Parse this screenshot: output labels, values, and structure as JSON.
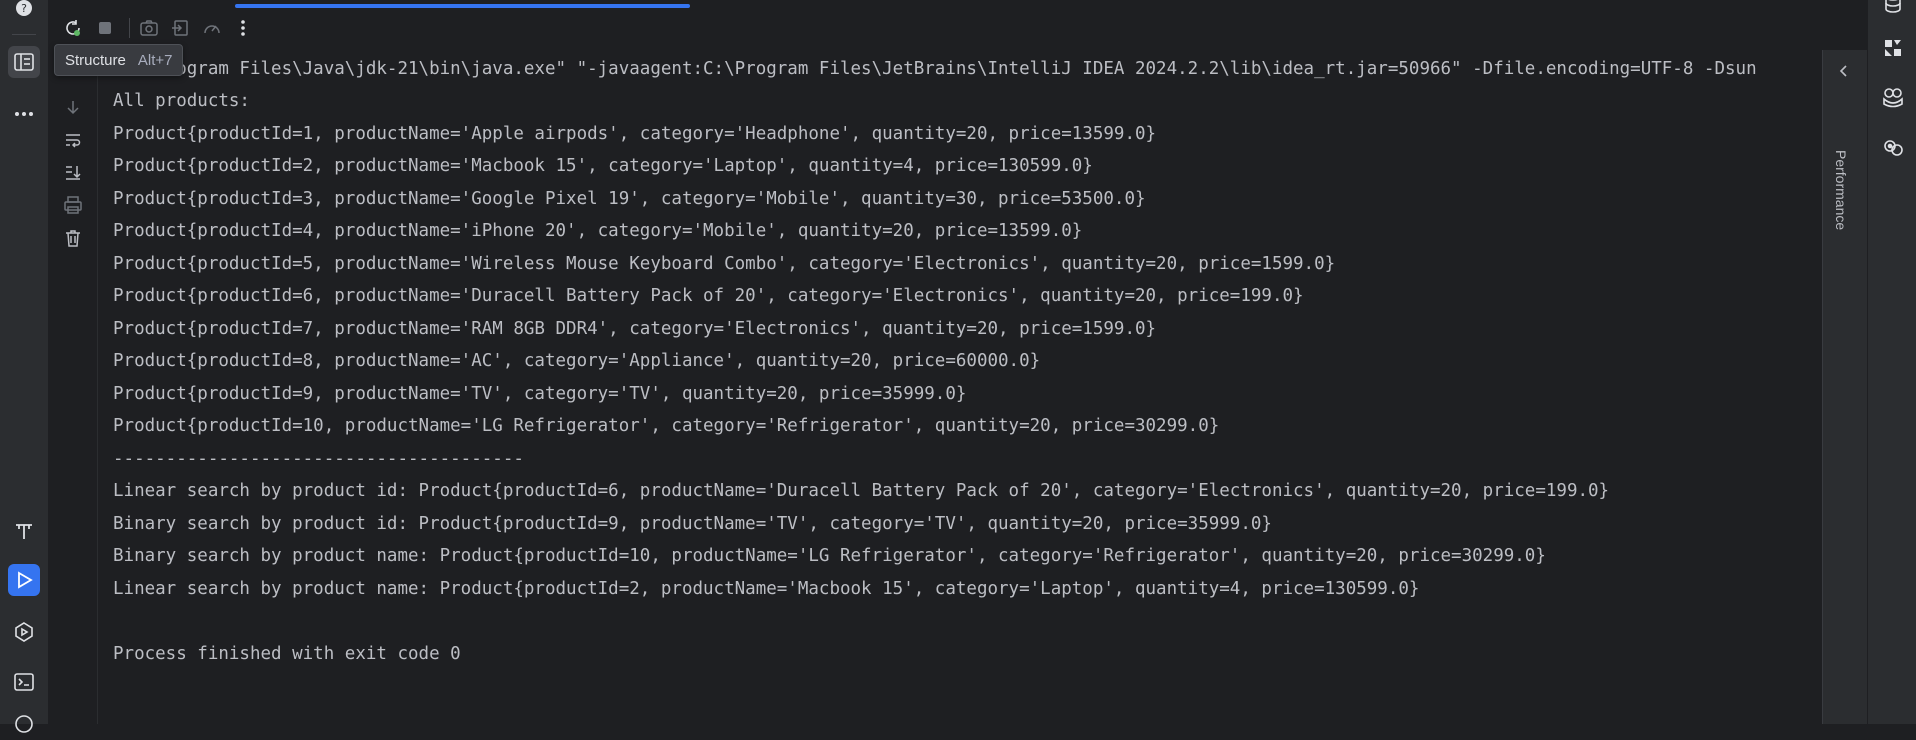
{
  "tooltip": {
    "title": "Structure",
    "shortcut": "Alt+7"
  },
  "right_panel": {
    "label": "Performance"
  },
  "console": {
    "lines": [
      "\"C:\\Program Files\\Java\\jdk-21\\bin\\java.exe\" \"-javaagent:C:\\Program Files\\JetBrains\\IntelliJ IDEA 2024.2.2\\lib\\idea_rt.jar=50966\" -Dfile.encoding=UTF-8 -Dsun",
      "All products:",
      "Product{productId=1, productName='Apple airpods', category='Headphone', quantity=20, price=13599.0}",
      "Product{productId=2, productName='Macbook 15', category='Laptop', quantity=4, price=130599.0}",
      "Product{productId=3, productName='Google Pixel 19', category='Mobile', quantity=30, price=53500.0}",
      "Product{productId=4, productName='iPhone 20', category='Mobile', quantity=20, price=13599.0}",
      "Product{productId=5, productName='Wireless Mouse Keyboard Combo', category='Electronics', quantity=20, price=1599.0}",
      "Product{productId=6, productName='Duracell Battery Pack of 20', category='Electronics', quantity=20, price=199.0}",
      "Product{productId=7, productName='RAM 8GB DDR4', category='Electronics', quantity=20, price=1599.0}",
      "Product{productId=8, productName='AC', category='Appliance', quantity=20, price=60000.0}",
      "Product{productId=9, productName='TV', category='TV', quantity=20, price=35999.0}",
      "Product{productId=10, productName='LG Refrigerator', category='Refrigerator', quantity=20, price=30299.0}",
      "---------------------------------------",
      "Linear search by product id: Product{productId=6, productName='Duracell Battery Pack of 20', category='Electronics', quantity=20, price=199.0}",
      "Binary search by product id: Product{productId=9, productName='TV', category='TV', quantity=20, price=35999.0}",
      "Binary search by product name: Product{productId=10, productName='LG Refrigerator', category='Refrigerator', quantity=20, price=30299.0}",
      "Linear search by product name: Product{productId=2, productName='Macbook 15', category='Laptop', quantity=4, price=130599.0}",
      "",
      "Process finished with exit code 0"
    ]
  },
  "icons": {
    "left_bar": [
      "notifications-icon",
      "structure-icon",
      "more-icon",
      "text-tool-icon",
      "run-icon",
      "services-icon",
      "terminal-icon",
      "problems-icon"
    ],
    "toolbar": [
      "rerun-icon",
      "stop-icon",
      "screenshot-icon",
      "exit-icon",
      "profiler-icon",
      "more-options-icon"
    ],
    "console_tools": [
      "scroll-down-icon",
      "soft-wrap-icon",
      "scroll-to-end-icon",
      "print-icon",
      "trash-icon"
    ],
    "right_bar": [
      "database-icon",
      "plugin-icon",
      "copilot-icon",
      "assistant-icon"
    ]
  },
  "colors": {
    "accent": "#3574f0",
    "background": "#1e1f22",
    "panel": "#2b2d30",
    "text": "#bcbec4"
  }
}
